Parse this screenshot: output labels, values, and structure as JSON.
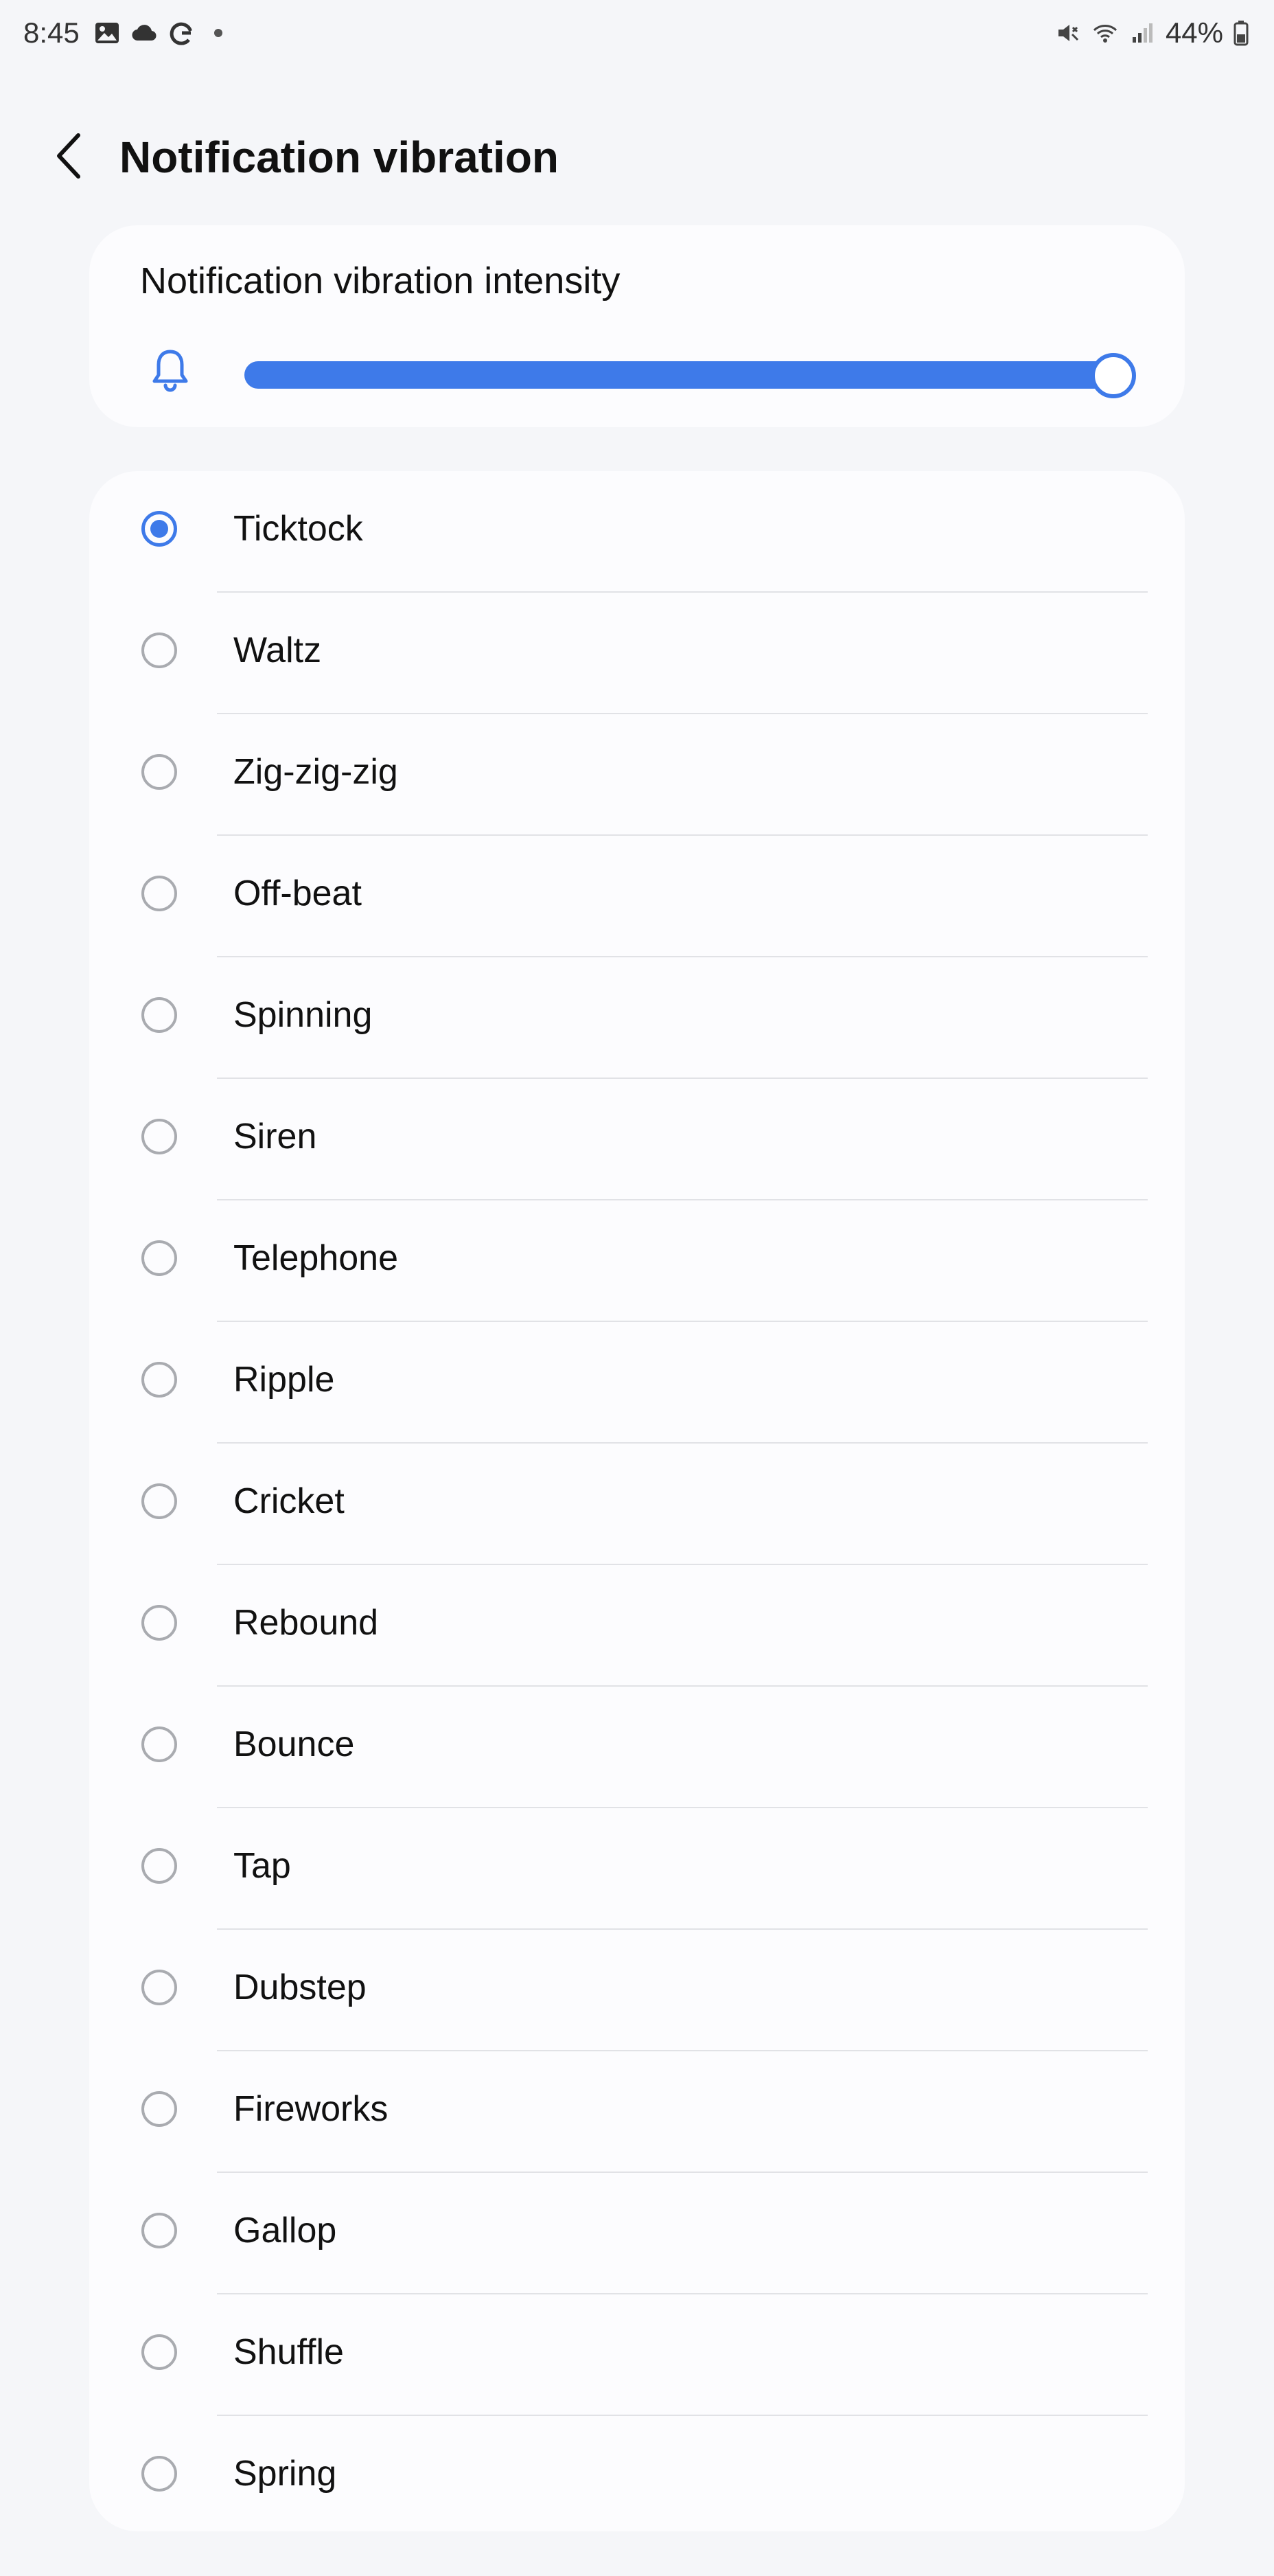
{
  "status_bar": {
    "time": "8:45",
    "left_icons": [
      "image-icon",
      "cloud-icon",
      "google-icon"
    ],
    "right_icons": [
      "mute-vibrate-icon",
      "wifi-icon",
      "signal-icon",
      "battery-icon"
    ],
    "battery": "44%"
  },
  "header": {
    "back_icon": "chevron-left-icon",
    "title": "Notification vibration"
  },
  "intensity": {
    "title": "Notification vibration intensity",
    "icon": "bell-icon",
    "level": 1.0
  },
  "patterns": {
    "selected_index": 0,
    "items": [
      {
        "label": "Ticktock"
      },
      {
        "label": "Waltz"
      },
      {
        "label": "Zig-zig-zig"
      },
      {
        "label": "Off-beat"
      },
      {
        "label": "Spinning"
      },
      {
        "label": "Siren"
      },
      {
        "label": "Telephone"
      },
      {
        "label": "Ripple"
      },
      {
        "label": "Cricket"
      },
      {
        "label": "Rebound"
      },
      {
        "label": "Bounce"
      },
      {
        "label": "Tap"
      },
      {
        "label": "Dubstep"
      },
      {
        "label": "Fireworks"
      },
      {
        "label": "Gallop"
      },
      {
        "label": "Shuffle"
      },
      {
        "label": "Spring"
      }
    ]
  },
  "colors": {
    "accent": "#3e7ae9",
    "background": "#f5f6f9",
    "card": "#fcfcfe",
    "radio_off": "#a9abb0"
  }
}
